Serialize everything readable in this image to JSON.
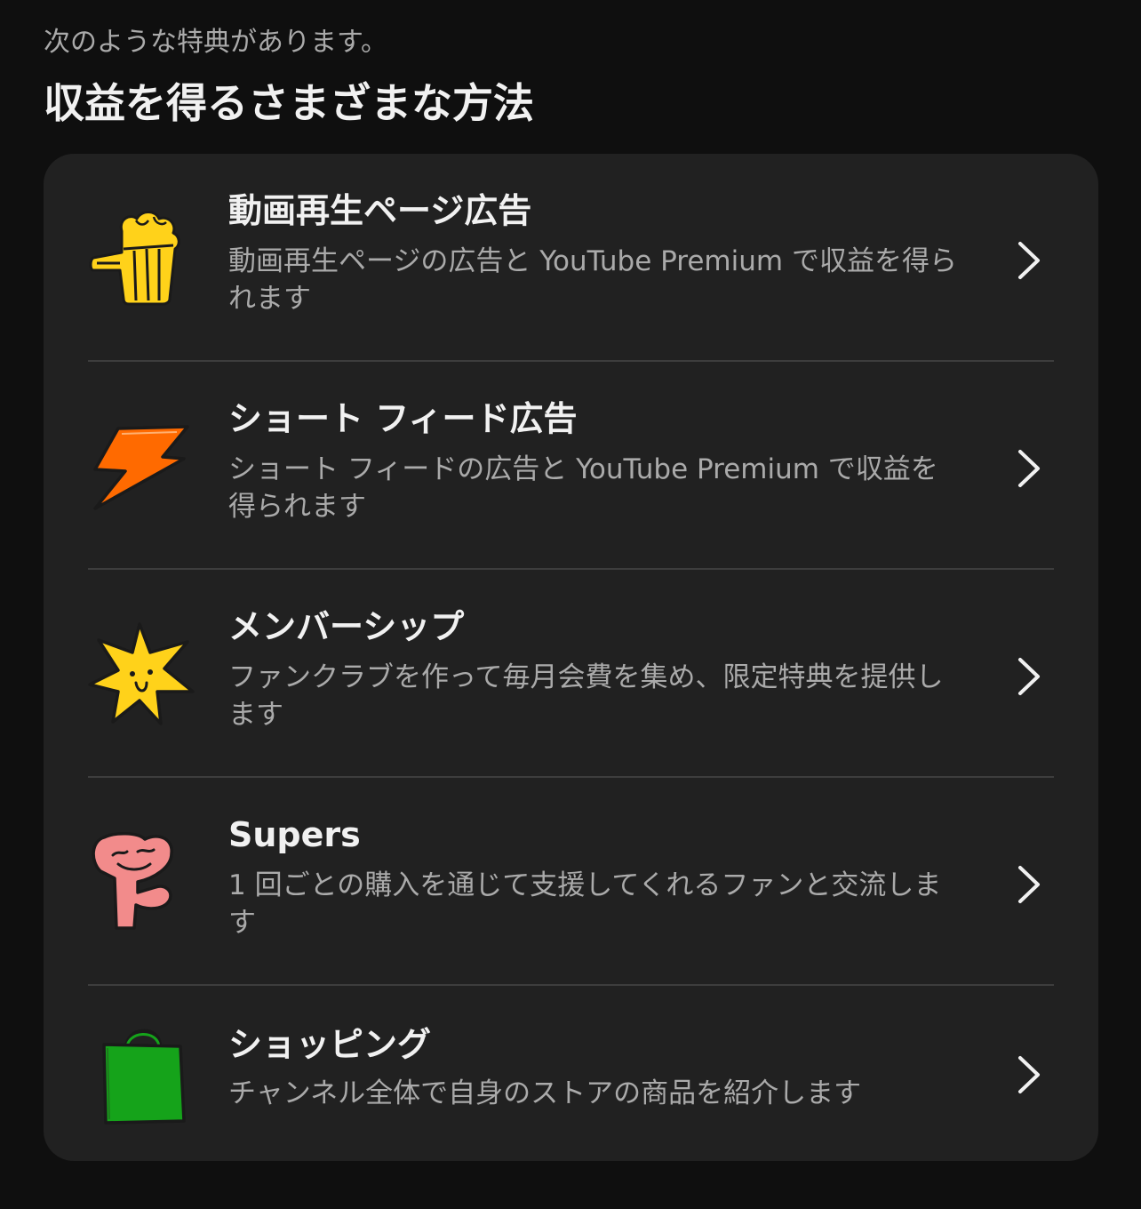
{
  "header": {
    "subtitle": "次のような特典があります。",
    "title": "収益を得るさまざまな方法"
  },
  "methods": [
    {
      "title": "動画再生ページ広告",
      "description": "動画再生ページの広告と YouTube Premium で収益を得られます",
      "icon": "popcorn-icon",
      "icon_color": "#ffd21a"
    },
    {
      "title": "ショート フィード広告",
      "description": "ショート フィードの広告と YouTube Premium で収益を得られます",
      "icon": "lightning-bolt-icon",
      "icon_color": "#ff6a00"
    },
    {
      "title": "メンバーシップ",
      "description": "ファンクラブを作って毎月会費を集め、限定特典を提供します",
      "icon": "star-icon",
      "icon_color": "#ffd21a"
    },
    {
      "title": "Supers",
      "description": "1 回ごとの購入を通じて支援してくれるファンと交流します",
      "icon": "heart-character-icon",
      "icon_color": "#f28b8b"
    },
    {
      "title": "ショッピング",
      "description": "チャンネル全体で自身のストアの商品を紹介します",
      "icon": "shopping-bag-icon",
      "icon_color": "#15a31a"
    }
  ],
  "colors": {
    "background": "#0f0f0f",
    "card": "#212121",
    "divider": "#3d3d3d",
    "primary_text": "#f1f1f1",
    "secondary_text": "#aaaaaa"
  }
}
